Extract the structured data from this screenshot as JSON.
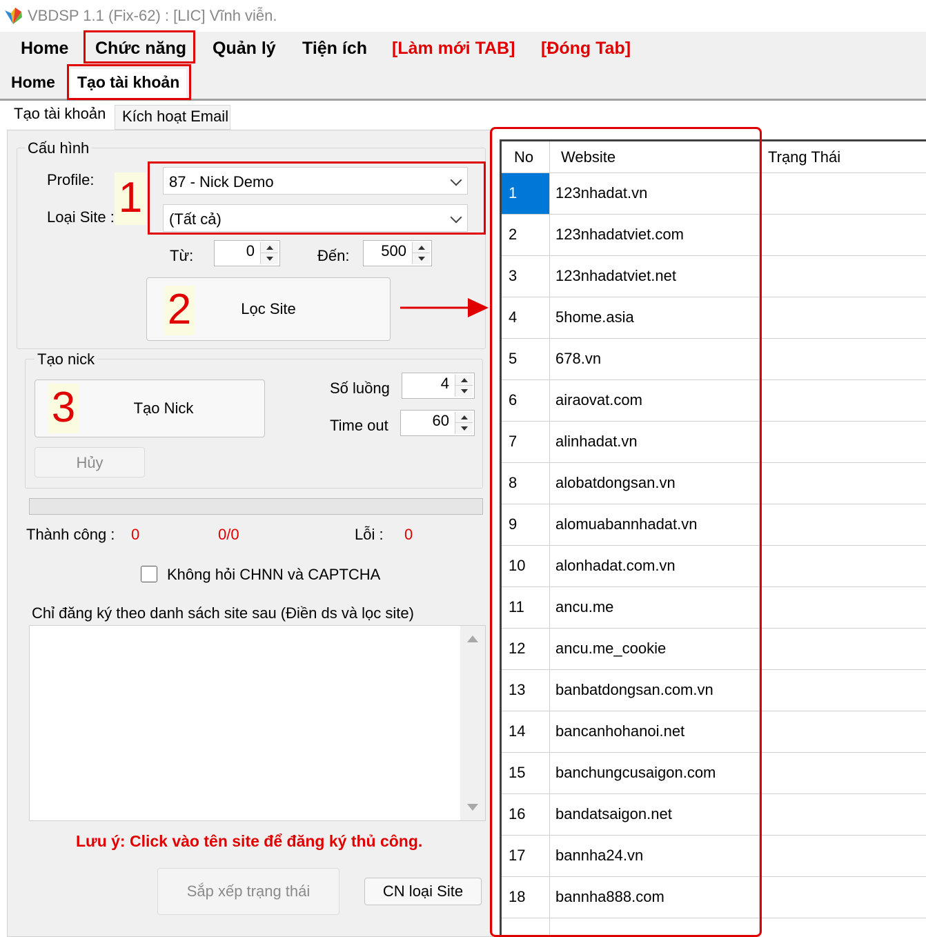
{
  "window": {
    "title": "VBDSP 1.1 (Fix-62) : [LIC] Vĩnh viễn."
  },
  "menu": {
    "home": "Home",
    "functions": "Chức năng",
    "manage": "Quản lý",
    "utilities": "Tiện ích",
    "refresh_tab": "[Làm mới TAB]",
    "close_tab": "[Đóng Tab]"
  },
  "doc_tabs": {
    "home": "Home",
    "create_account": "Tạo tài khoản"
  },
  "inner_tabs": {
    "create_account": "Tạo tài khoản",
    "activate_email": "Kích hoạt Email"
  },
  "config": {
    "legend": "Cấu hình",
    "profile_label": "Profile:",
    "profile_value": "87 - Nick Demo",
    "site_type_label": "Loại Site :",
    "site_type_value": "(Tất cả)",
    "from_label": "Từ:",
    "from_value": "0",
    "to_label": "Đến:",
    "to_value": "500",
    "filter_button": "Lọc Site"
  },
  "create_nick": {
    "legend": "Tạo nick",
    "create_button": "Tạo Nick",
    "cancel_button": "Hủy",
    "threads_label": "Số luồng",
    "threads_value": "4",
    "timeout_label": "Time out",
    "timeout_value": "60"
  },
  "stats": {
    "success_label": "Thành công :",
    "success_value": "0",
    "progress_value": "0/0",
    "error_label": "Lỗi :",
    "error_value": "0"
  },
  "captcha_checkbox": {
    "label": "Không hỏi CHNN và CAPTCHA",
    "checked": false
  },
  "site_list": {
    "label": "Chỉ đăng ký theo danh sách site sau (Điền ds và lọc site)",
    "value": ""
  },
  "note": "Lưu ý: Click vào tên site để đăng ký thủ công.",
  "bottom_buttons": {
    "sort_status": "Sắp xếp trạng thái",
    "update_site_type": "CN loại Site"
  },
  "annotations": {
    "step1": "1",
    "step2": "2",
    "step3": "3"
  },
  "grid": {
    "headers": {
      "no": "No",
      "website": "Website",
      "status": "Trạng Thái"
    },
    "rows": [
      {
        "no": "1",
        "website": "123nhadat.vn",
        "status": ""
      },
      {
        "no": "2",
        "website": "123nhadatviet.com",
        "status": ""
      },
      {
        "no": "3",
        "website": "123nhadatviet.net",
        "status": ""
      },
      {
        "no": "4",
        "website": "5home.asia",
        "status": ""
      },
      {
        "no": "5",
        "website": "678.vn",
        "status": ""
      },
      {
        "no": "6",
        "website": "airaovat.com",
        "status": ""
      },
      {
        "no": "7",
        "website": "alinhadat.vn",
        "status": ""
      },
      {
        "no": "8",
        "website": "alobatdongsan.vn",
        "status": ""
      },
      {
        "no": "9",
        "website": "alomuabannhadat.vn",
        "status": ""
      },
      {
        "no": "10",
        "website": "alonhadat.com.vn",
        "status": ""
      },
      {
        "no": "11",
        "website": "ancu.me",
        "status": ""
      },
      {
        "no": "12",
        "website": "ancu.me_cookie",
        "status": ""
      },
      {
        "no": "13",
        "website": "banbatdongsan.com.vn",
        "status": ""
      },
      {
        "no": "14",
        "website": "bancanhohanoi.net",
        "status": ""
      },
      {
        "no": "15",
        "website": "banchungcusaigon.com",
        "status": ""
      },
      {
        "no": "16",
        "website": "bandatsaigon.net",
        "status": ""
      },
      {
        "no": "17",
        "website": "bannha24.vn",
        "status": ""
      },
      {
        "no": "18",
        "website": "bannha888.com",
        "status": ""
      }
    ]
  },
  "colors": {
    "accent_red": "#e00000",
    "selection_blue": "#0078d7"
  }
}
